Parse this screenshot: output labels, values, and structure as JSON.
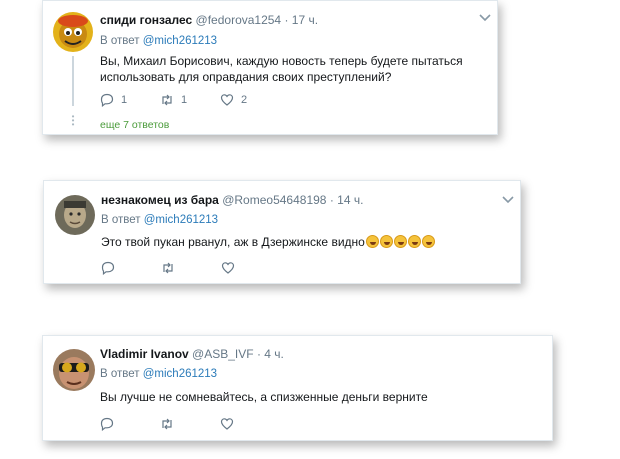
{
  "tweets": [
    {
      "name": "спиди гонзалес",
      "handle": "@fedorova1254",
      "time": "17 ч.",
      "reply_prefix": "В ответ",
      "reply_mention": "@mich261213",
      "text": "Вы, Михаил Борисович, каждую новость теперь будете пытаться использовать для оправдания своих преступлений?",
      "replies": "1",
      "retweets": "1",
      "likes": "2",
      "more_replies": "еще 7 ответов"
    },
    {
      "name": "незнакомец из бара",
      "handle": "@Romeo54648198",
      "time": "14 ч.",
      "reply_prefix": "В ответ",
      "reply_mention": "@mich261213",
      "text": "Это твой пукан рванул, аж в Дзержинске видно",
      "emoji_count": 5
    },
    {
      "name": "Vladimir Ivanov",
      "handle": "@ASB_IVF",
      "time": "4 ч.",
      "reply_prefix": "В ответ",
      "reply_mention": "@mich261213",
      "text": "Вы лучше не сомневайтесь, а спизженные деньги верните"
    }
  ],
  "separator": "·",
  "colors": {
    "name": "#14171a",
    "muted": "#657786",
    "mention": "#2b7bb9",
    "more_link": "#4a9b3a",
    "card_border": "#e1e8ed"
  },
  "icons": [
    "reply-icon",
    "retweet-icon",
    "like-icon",
    "chevron-down-icon"
  ]
}
